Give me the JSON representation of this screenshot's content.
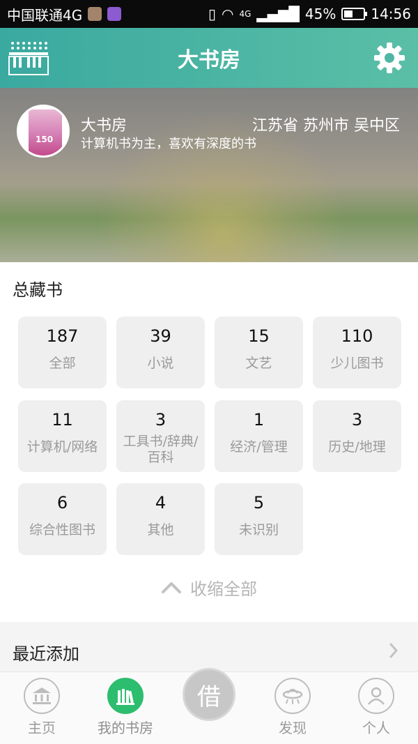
{
  "status_bar": {
    "carrier": "中国联通4G",
    "network": "4G",
    "battery": "45%",
    "time": "14:56"
  },
  "header": {
    "title": "大书房",
    "left_icon": "piano-icon",
    "right_icon": "gear-icon"
  },
  "profile": {
    "name": "大书房",
    "location": "江苏省 苏州市 吴中区",
    "description": "计算机书为主，喜欢有深度的书",
    "avatar_cover_number": "150"
  },
  "collection": {
    "title": "总藏书",
    "tiles": [
      {
        "count": "187",
        "label": "全部"
      },
      {
        "count": "39",
        "label": "小说"
      },
      {
        "count": "15",
        "label": "文艺"
      },
      {
        "count": "110",
        "label": "少儿图书"
      },
      {
        "count": "11",
        "label": "计算机/网络"
      },
      {
        "count": "3",
        "label": "工具书/辞典/百科"
      },
      {
        "count": "1",
        "label": "经济/管理"
      },
      {
        "count": "3",
        "label": "历史/地理"
      },
      {
        "count": "6",
        "label": "综合性图书"
      },
      {
        "count": "4",
        "label": "其他"
      },
      {
        "count": "5",
        "label": "未识别"
      }
    ],
    "collapse_label": "收缩全部"
  },
  "recent": {
    "title": "最近添加"
  },
  "bottom_nav": {
    "items": [
      {
        "label": "主页",
        "icon": "home-icon"
      },
      {
        "label": "我的书房",
        "icon": "bookshelf-icon"
      },
      {
        "label": "借",
        "icon": "borrow-icon"
      },
      {
        "label": "发现",
        "icon": "ufo-icon"
      },
      {
        "label": "个人",
        "icon": "user-icon"
      }
    ]
  },
  "colors": {
    "header_start": "#3aa9a0",
    "header_end": "#5bbfa6",
    "active_nav": "#2dbd6e",
    "tile_bg": "#efefef"
  }
}
